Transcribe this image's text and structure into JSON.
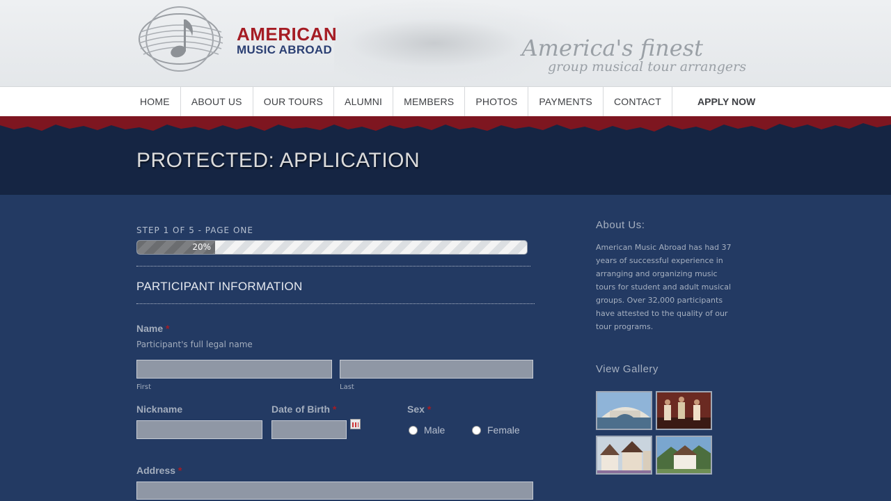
{
  "brand": {
    "line1": "AMERICAN",
    "line2": "MUSIC ABROAD",
    "tagline_1": "America's finest",
    "tagline_2": "group musical tour arrangers",
    "color_red": "#a51c24",
    "color_blue": "#2b3f73"
  },
  "nav": {
    "items": [
      "HOME",
      "ABOUT US",
      "OUR TOURS",
      "ALUMNI",
      "MEMBERS",
      "PHOTOS",
      "PAYMENTS",
      "CONTACT"
    ],
    "apply": "APPLY NOW"
  },
  "page_title": "PROTECTED: APPLICATION",
  "form": {
    "step_label": "STEP 1 OF 5 - PAGE ONE",
    "progress_percent": 20,
    "progress_text": "20%",
    "section_title": "PARTICIPANT INFORMATION",
    "name_label": "Name",
    "required_mark": "*",
    "name_desc": "Participant's full legal name",
    "first_sublabel": "First",
    "last_sublabel": "Last",
    "nickname_label": "Nickname",
    "dob_label": "Date of Birth",
    "sex_label": "Sex",
    "sex_options": [
      "Male",
      "Female"
    ],
    "address_label": "Address",
    "calendar_icon": "calendar-icon"
  },
  "sidebar": {
    "about_heading": "About Us:",
    "about_text": "American Music Abroad has had 37 years of successful experience in arranging and organizing music tours for student and adult musical groups. Over 32,000 participants have attested to the quality of our tour programs.",
    "gallery_heading": "View Gallery"
  }
}
